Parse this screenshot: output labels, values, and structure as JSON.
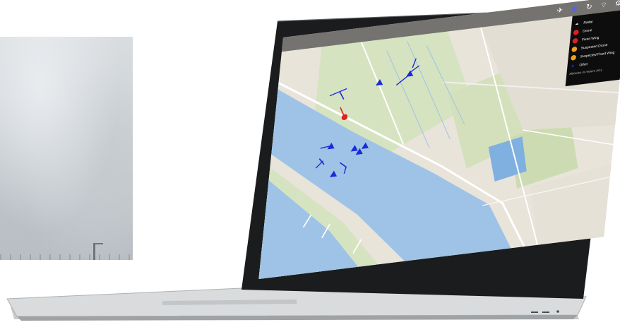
{
  "scene": {
    "photo": "cloudy-sky-panel"
  },
  "app": {
    "toolbar": {
      "status_text": "",
      "icons": [
        "aircraft-filter-icon",
        "radar-toggle-icon",
        "refresh-icon",
        "wifi-icon",
        "settings-icon"
      ],
      "active_icon": "radar-toggle-icon"
    },
    "legend": {
      "items": [
        {
          "label": "Radar",
          "color": "#ffffff",
          "glyph": "☁"
        },
        {
          "label": "Drone",
          "color": "#e02020",
          "glyph": ""
        },
        {
          "label": "Fixed Wing",
          "color": "#e02020",
          "glyph": ""
        },
        {
          "label": "Suspected Drone",
          "color": "#f0a020",
          "glyph": ""
        },
        {
          "label": "Suspected Fixed Wing",
          "color": "#f0a020",
          "glyph": ""
        },
        {
          "label": "Other",
          "color": "#1a2bd6",
          "glyph": ""
        }
      ],
      "note": "Altitudes in meters AGL"
    },
    "map": {
      "colors": {
        "water": "#9ec3e6",
        "land": "#e8e4da",
        "green": "#cfdfb5",
        "road": "#ffffff",
        "track": "#1a2bd6",
        "alert": "#e02020"
      }
    }
  }
}
